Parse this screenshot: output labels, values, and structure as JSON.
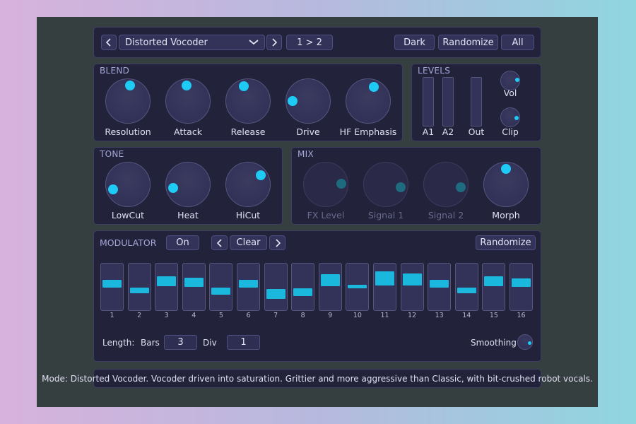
{
  "toolbar": {
    "prev_label": "<",
    "preset": "Distorted Vocoder",
    "next_label": ">",
    "route": "1 > 2",
    "theme": "Dark",
    "randomize": "Randomize",
    "all": "All"
  },
  "blend": {
    "title": "BLEND",
    "knobs": [
      {
        "label": "Resolution",
        "value": 0.53
      },
      {
        "label": "Attack",
        "value": 0.48
      },
      {
        "label": "Release",
        "value": 0.44
      },
      {
        "label": "Drive",
        "value": 0.17
      },
      {
        "label": "HF Emphasis",
        "value": 0.58
      }
    ]
  },
  "levels": {
    "title": "LEVELS",
    "meters": [
      "A1",
      "A2",
      "Out"
    ],
    "knobs": [
      {
        "label": "Vol",
        "value": 0.82
      },
      {
        "label": "Clip",
        "value": 0.85
      }
    ]
  },
  "tone": {
    "title": "TONE",
    "knobs": [
      {
        "label": "LowCut",
        "value": 0.1
      },
      {
        "label": "Heat",
        "value": 0.12
      },
      {
        "label": "HiCut",
        "value": 0.7
      }
    ]
  },
  "mix": {
    "title": "MIX",
    "knobs": [
      {
        "label": "FX Level",
        "value": 0.82,
        "enabled": false
      },
      {
        "label": "Signal 1",
        "value": 0.87,
        "enabled": false
      },
      {
        "label": "Signal 2",
        "value": 0.87,
        "enabled": false
      },
      {
        "label": "Morph",
        "value": 0.5,
        "enabled": true
      }
    ]
  },
  "modulator": {
    "title": "MODULATOR",
    "on_label": "On",
    "prev_label": "<",
    "pattern": "Clear",
    "next_label": ">",
    "randomize": "Randomize",
    "steps": [
      {
        "num": "1",
        "level": 0.58
      },
      {
        "num": "2",
        "level": 0.44
      },
      {
        "num": "3",
        "level": 0.63
      },
      {
        "num": "4",
        "level": 0.61
      },
      {
        "num": "5",
        "level": 0.43
      },
      {
        "num": "6",
        "level": 0.58
      },
      {
        "num": "7",
        "level": 0.37
      },
      {
        "num": "8",
        "level": 0.41
      },
      {
        "num": "9",
        "level": 0.66
      },
      {
        "num": "10",
        "level": 0.52
      },
      {
        "num": "11",
        "level": 0.69
      },
      {
        "num": "12",
        "level": 0.67
      },
      {
        "num": "13",
        "level": 0.58
      },
      {
        "num": "14",
        "level": 0.44
      },
      {
        "num": "15",
        "level": 0.63
      },
      {
        "num": "16",
        "level": 0.6
      }
    ],
    "length_label": "Length:",
    "bars_label": "Bars",
    "bars_value": "3",
    "div_label": "Div",
    "div_value": "1",
    "smoothing_label": "Smoothing",
    "smoothing_value": 0.87
  },
  "status": "Mode: Distorted Vocoder. Vocoder driven into saturation. Grittier and more aggressive than Classic, with bit-crushed robot vocals.",
  "colors": {
    "accent": "#1ecbf5",
    "panel": "#22223a",
    "frame": "#363f40"
  }
}
